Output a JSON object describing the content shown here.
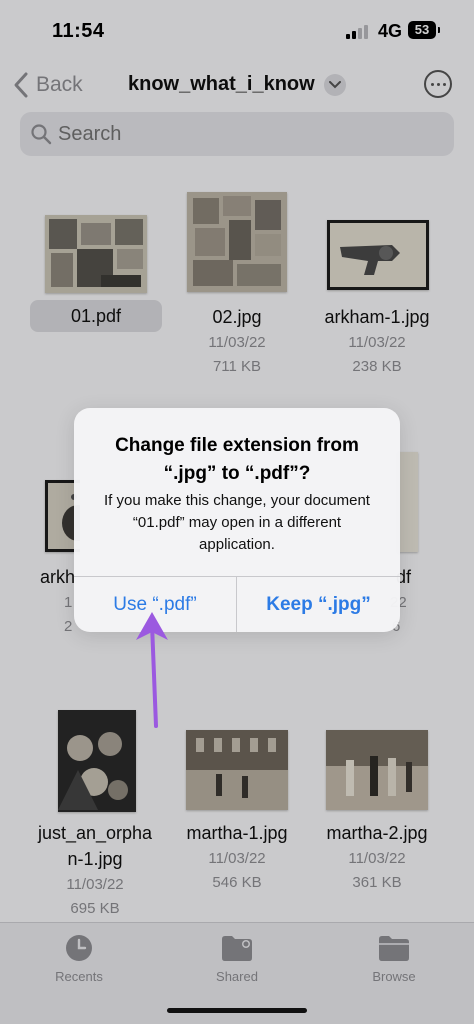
{
  "status_bar": {
    "time": "11:54",
    "network": "4G",
    "battery": "53"
  },
  "nav": {
    "back_label": "Back",
    "folder_title": "know_what_i_know"
  },
  "search": {
    "placeholder": "Search"
  },
  "files": [
    {
      "name": "01.pdf",
      "date": "",
      "size": ""
    },
    {
      "name": "02.jpg",
      "date": "11/03/22",
      "size": "711 KB"
    },
    {
      "name": "arkham-1.jpg",
      "date": "11/03/22",
      "size": "238 KB"
    },
    {
      "name": "arkh",
      "date": "1",
      "size": "2"
    },
    {
      "name": "df",
      "date": "22",
      "size": "6"
    },
    {
      "name_line1": "just_an_orpha",
      "name_line2": "n-1.jpg",
      "date": "11/03/22",
      "size": "695 KB"
    },
    {
      "name": "martha-1.jpg",
      "date": "11/03/22",
      "size": "546 KB"
    },
    {
      "name": "martha-2.jpg",
      "date": "11/03/22",
      "size": "361 KB"
    }
  ],
  "dialog": {
    "title": "Change file extension from “.jpg” to “.pdf”?",
    "message": "If you make this change, your document “01.pdf” may open in a different application.",
    "use_label": "Use “.pdf”",
    "keep_label": "Keep “.jpg”"
  },
  "tabs": [
    {
      "label": "Recents",
      "icon": "clock-icon"
    },
    {
      "label": "Shared",
      "icon": "shared-folder-icon"
    },
    {
      "label": "Browse",
      "icon": "folder-icon"
    }
  ],
  "colors": {
    "accent": "#2c7be5",
    "annotation_arrow": "#9b59e0"
  }
}
